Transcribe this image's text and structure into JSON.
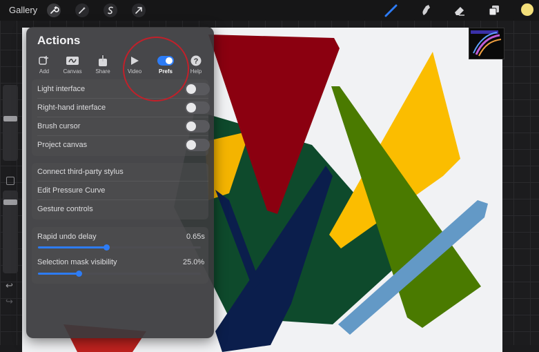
{
  "topbar": {
    "gallery_label": "Gallery",
    "left_tools": [
      "wrench-icon",
      "magic-wand-icon",
      "selection-s-icon",
      "transform-arrow-icon"
    ],
    "right_tools": [
      "brush-icon",
      "smudge-icon",
      "eraser-icon",
      "layers-icon",
      "color-swatch"
    ],
    "active_color": "#f3df7a"
  },
  "panel": {
    "title": "Actions",
    "tabs": [
      {
        "label": "Add",
        "icon": "add-icon"
      },
      {
        "label": "Canvas",
        "icon": "canvas-icon"
      },
      {
        "label": "Share",
        "icon": "share-icon"
      },
      {
        "label": "Video",
        "icon": "play-icon"
      },
      {
        "label": "Prefs",
        "icon": "toggle-icon"
      },
      {
        "label": "Help",
        "icon": "help-icon"
      }
    ],
    "active_tab": "Prefs",
    "toggles": [
      {
        "label": "Light interface",
        "on": false
      },
      {
        "label": "Right-hand interface",
        "on": false
      },
      {
        "label": "Brush cursor",
        "on": false
      },
      {
        "label": "Project canvas",
        "on": false
      }
    ],
    "links": [
      "Connect third-party stylus",
      "Edit Pressure Curve",
      "Gesture controls"
    ],
    "sliders": [
      {
        "label": "Rapid undo delay",
        "value": "0.65s",
        "fraction": 0.42
      },
      {
        "label": "Selection mask visibility",
        "value": "25.0%",
        "fraction": 0.25
      }
    ]
  },
  "accent_color": "#2d7cf6",
  "annotation_color": "#c2202a"
}
